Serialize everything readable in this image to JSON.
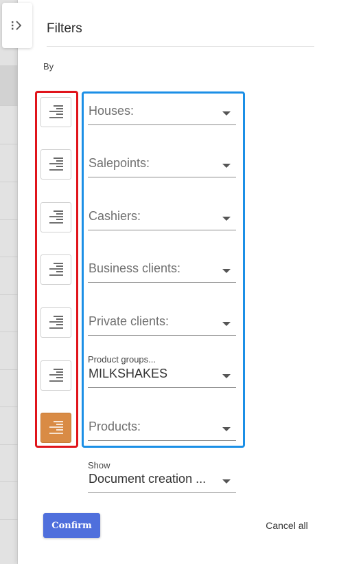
{
  "panel": {
    "title": "Filters",
    "by_label": "By",
    "collapse_icon": "collapse-chevron-icon"
  },
  "order_buttons": [
    {
      "icon": "sort-lines-icon",
      "active": false
    },
    {
      "icon": "sort-lines-icon",
      "active": false
    },
    {
      "icon": "sort-lines-icon",
      "active": false
    },
    {
      "icon": "sort-lines-icon",
      "active": false
    },
    {
      "icon": "sort-lines-icon",
      "active": false
    },
    {
      "icon": "sort-lines-icon",
      "active": false
    },
    {
      "icon": "sort-lines-icon",
      "active": true
    }
  ],
  "filters": [
    {
      "label": "Houses:",
      "value": ""
    },
    {
      "label": "Salepoints:",
      "value": ""
    },
    {
      "label": "Cashiers:",
      "value": ""
    },
    {
      "label": "Business clients:",
      "value": ""
    },
    {
      "label": "Private clients:",
      "value": ""
    },
    {
      "label": "Product groups...",
      "value": "MILKSHAKES"
    },
    {
      "label": "Products:",
      "value": ""
    }
  ],
  "show": {
    "label": "Show",
    "value": "Document creation ..."
  },
  "actions": {
    "confirm_label": "Confirm",
    "cancel_label": "Cancel all"
  },
  "colors": {
    "highlight_red": "#e0141b",
    "highlight_blue": "#1b8fe6",
    "active_order": "#d98b45",
    "confirm": "#4f6fdc"
  }
}
